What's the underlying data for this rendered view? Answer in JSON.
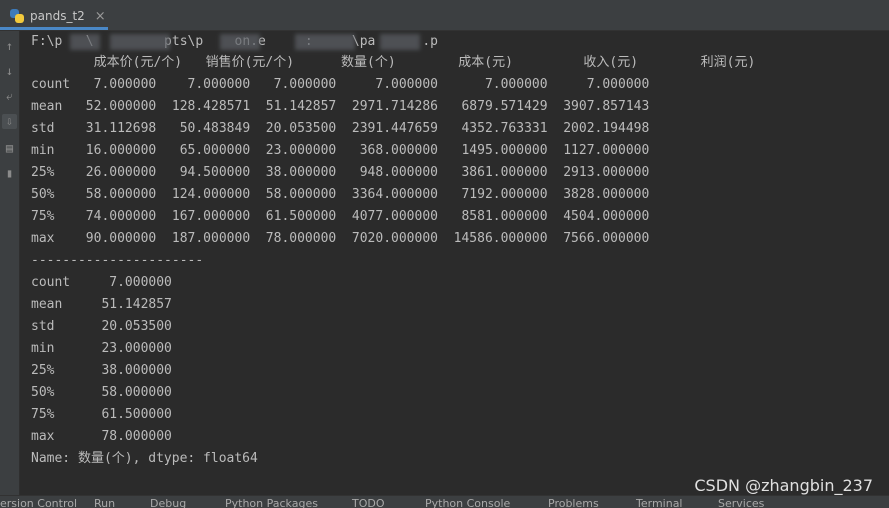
{
  "editor": {
    "tab_label": "pands_t2",
    "tab_close": "×"
  },
  "gutter_icons": [
    "arrow-up-icon",
    "arrow-down-icon",
    "soft-wrap-icon",
    "scroll-to-end-icon",
    "print-icon",
    "trash-icon"
  ],
  "console": {
    "path_line": "F:\\p   \\         pts\\p    on.e     :     \\pa      .p",
    "describe_header": "        成本价(元/个)   销售价(元/个)      数量(个)        成本(元)         收入(元)        利润(元)",
    "describe_rows": [
      "count   7.000000    7.000000   7.000000     7.000000      7.000000     7.000000",
      "mean   52.000000  128.428571  51.142857  2971.714286   6879.571429  3907.857143",
      "std    31.112698   50.483849  20.053500  2391.447659   4352.763331  2002.194498",
      "min    16.000000   65.000000  23.000000   368.000000   1495.000000  1127.000000",
      "25%    26.000000   94.500000  38.000000   948.000000   3861.000000  2913.000000",
      "50%    58.000000  124.000000  58.000000  3364.000000   7192.000000  3828.000000",
      "75%    74.000000  167.000000  61.500000  4077.000000   8581.000000  4504.000000",
      "max    90.000000  187.000000  78.000000  7020.000000  14586.000000  7566.000000"
    ],
    "separator": "----------------------",
    "series_rows": [
      "count     7.000000",
      "mean     51.142857",
      "std      20.053500",
      "min      23.000000",
      "25%      38.000000",
      "50%      58.000000",
      "75%      61.500000",
      "max      78.000000"
    ],
    "series_footer": "Name: 数量(个), dtype: float64"
  },
  "statusbar": {
    "items": [
      "ersion Control",
      "Run",
      "Debug",
      "Python Packages",
      "TODO",
      "Python Console",
      "Problems",
      "Terminal",
      "Services"
    ]
  },
  "watermark": "CSDN @zhangbin_237"
}
